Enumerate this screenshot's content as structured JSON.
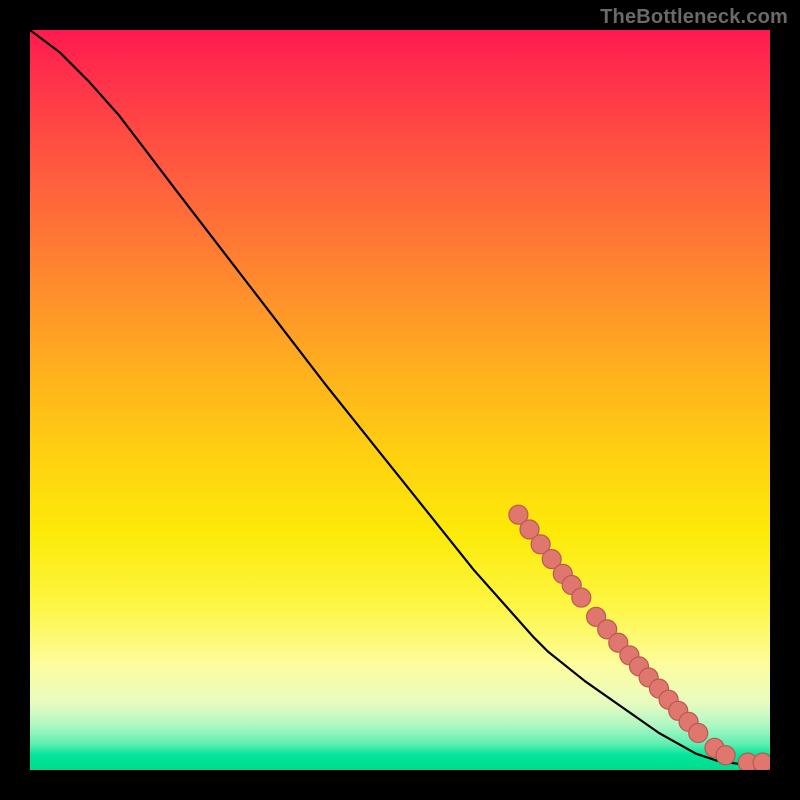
{
  "watermark": "TheBottleneck.com",
  "chart_data": {
    "type": "line",
    "title": "",
    "xlabel": "",
    "ylabel": "",
    "xlim": [
      0,
      100
    ],
    "ylim": [
      0,
      100
    ],
    "grid": false,
    "series": [
      {
        "name": "curve",
        "kind": "line",
        "color": "#000000",
        "points": [
          {
            "x": 0,
            "y": 100
          },
          {
            "x": 4,
            "y": 97
          },
          {
            "x": 8,
            "y": 93
          },
          {
            "x": 12,
            "y": 88.5
          },
          {
            "x": 20,
            "y": 78
          },
          {
            "x": 30,
            "y": 65
          },
          {
            "x": 40,
            "y": 52
          },
          {
            "x": 50,
            "y": 39.5
          },
          {
            "x": 60,
            "y": 27
          },
          {
            "x": 68,
            "y": 18
          },
          {
            "x": 70,
            "y": 16
          },
          {
            "x": 75,
            "y": 12
          },
          {
            "x": 80,
            "y": 8.5
          },
          {
            "x": 85,
            "y": 5
          },
          {
            "x": 90,
            "y": 2.2
          },
          {
            "x": 93,
            "y": 1.2
          },
          {
            "x": 96,
            "y": 0.8
          },
          {
            "x": 98,
            "y": 0.8
          },
          {
            "x": 100,
            "y": 1
          }
        ]
      },
      {
        "name": "highlighted-points",
        "kind": "scatter",
        "color": "#E0776E",
        "points": [
          {
            "x": 66,
            "y": 34.5
          },
          {
            "x": 67.5,
            "y": 32.5
          },
          {
            "x": 69,
            "y": 30.5
          },
          {
            "x": 70.5,
            "y": 28.5
          },
          {
            "x": 72,
            "y": 26.5
          },
          {
            "x": 73.2,
            "y": 25
          },
          {
            "x": 74.5,
            "y": 23.3
          },
          {
            "x": 76.5,
            "y": 20.7
          },
          {
            "x": 78,
            "y": 19
          },
          {
            "x": 79.5,
            "y": 17.2
          },
          {
            "x": 81,
            "y": 15.5
          },
          {
            "x": 82.3,
            "y": 14
          },
          {
            "x": 83.6,
            "y": 12.5
          },
          {
            "x": 85,
            "y": 11
          },
          {
            "x": 86.3,
            "y": 9.5
          },
          {
            "x": 87.6,
            "y": 8
          },
          {
            "x": 89,
            "y": 6.5
          },
          {
            "x": 90.3,
            "y": 5
          },
          {
            "x": 92.5,
            "y": 3
          },
          {
            "x": 94,
            "y": 2
          },
          {
            "x": 97,
            "y": 1
          },
          {
            "x": 99,
            "y": 1
          }
        ]
      }
    ]
  },
  "colors": {
    "background": "#000000",
    "watermark": "#6a6a6a",
    "curve": "#000000",
    "dot_fill": "#E0776E",
    "dot_stroke": "#B85A52"
  }
}
